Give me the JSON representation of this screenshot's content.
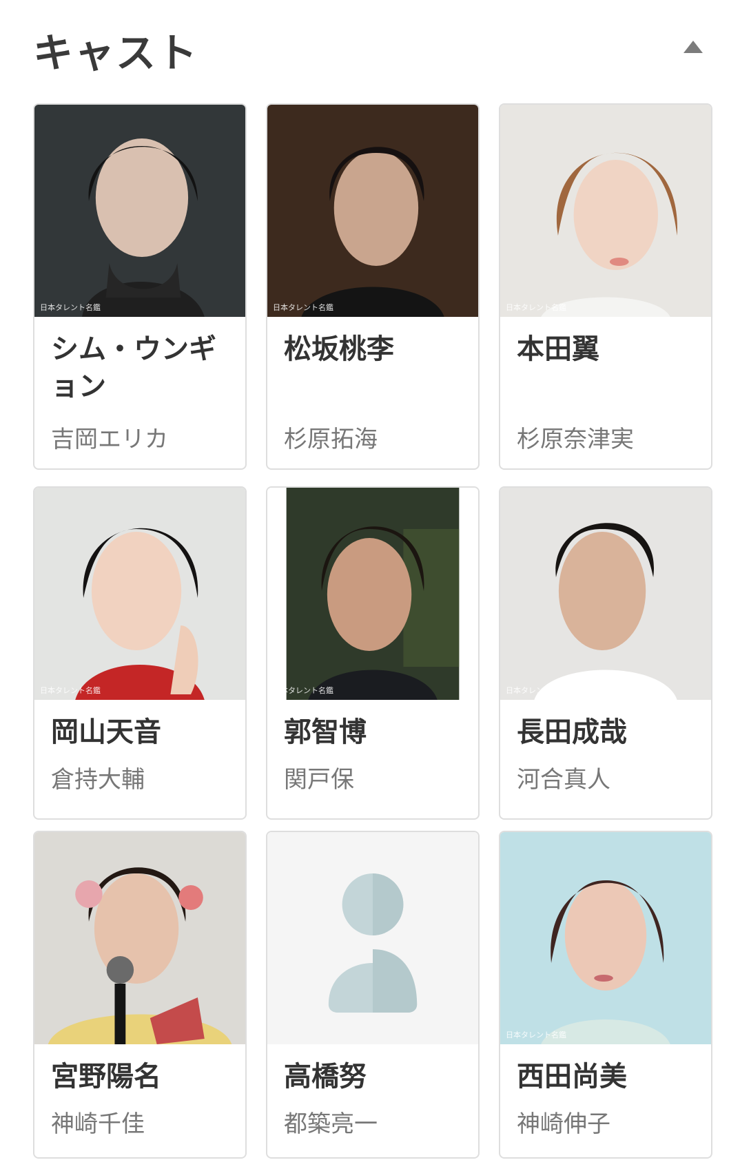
{
  "section": {
    "title": "キャスト"
  },
  "watermark": "日本タレント名鑑",
  "cast": [
    {
      "name": "シム・ウンギョン",
      "role": "吉岡エリカ"
    },
    {
      "name": "松坂桃李",
      "role": "杉原拓海"
    },
    {
      "name": "本田翼",
      "role": "杉原奈津実"
    },
    {
      "name": "岡山天音",
      "role": "倉持大輔"
    },
    {
      "name": "郭智博",
      "role": "関戸保"
    },
    {
      "name": "長田成哉",
      "role": "河合真人"
    },
    {
      "name": "宮野陽名",
      "role": "神崎千佳"
    },
    {
      "name": "高橋努",
      "role": "都築亮一"
    },
    {
      "name": "西田尚美",
      "role": "神崎伸子"
    }
  ]
}
